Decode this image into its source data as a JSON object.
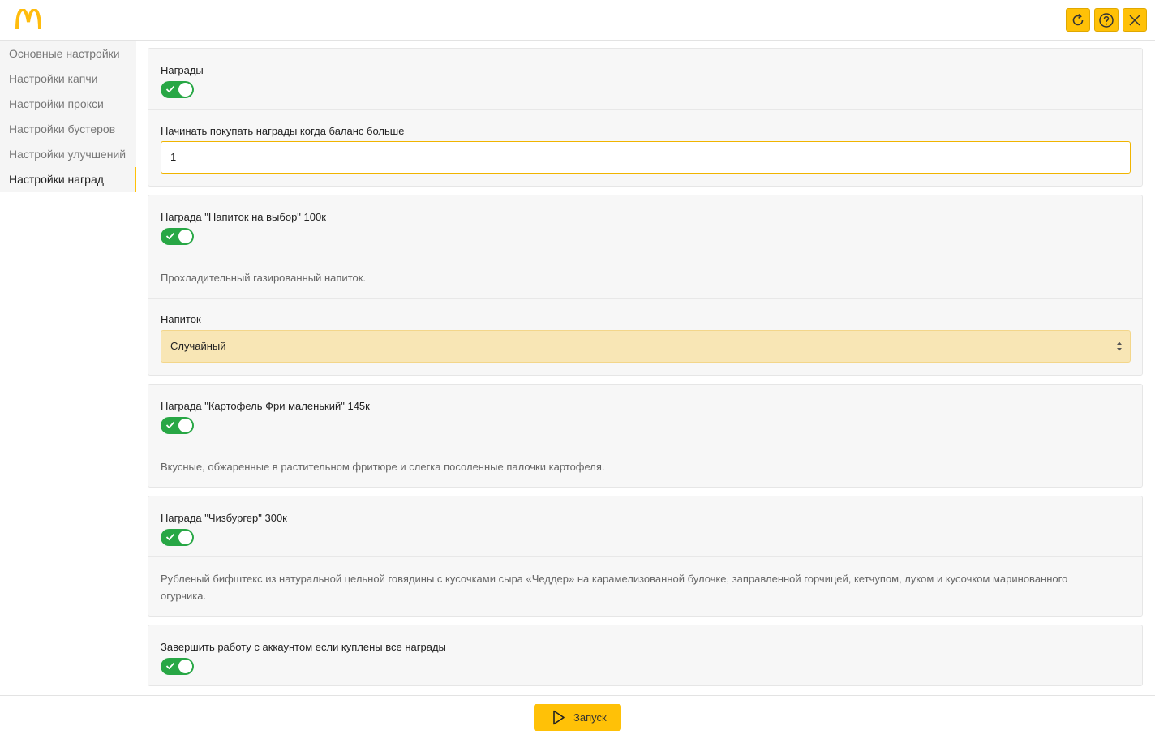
{
  "header": {
    "logo_icon": "mcdonalds-logo-icon",
    "buttons": {
      "refresh_icon": "refresh-icon",
      "help_icon": "help-circle-icon",
      "close_icon": "close-icon"
    },
    "accent_color": "#ffc107"
  },
  "sidebar": {
    "items": [
      {
        "label": "Основные настройки"
      },
      {
        "label": "Настройки капчи"
      },
      {
        "label": "Настройки прокси"
      },
      {
        "label": "Настройки бустеров"
      },
      {
        "label": "Настройки улучшений"
      },
      {
        "label": "Настройки наград",
        "active": true
      }
    ]
  },
  "rewards": {
    "enabled_label": "Награды",
    "enabled": true,
    "balance_label": "Начинать покупать награды когда баланс больше",
    "balance_value": "1"
  },
  "drink": {
    "title": "Награда \"Напиток на выбор\" 100к",
    "enabled": true,
    "description": "Прохладительный газированный напиток.",
    "select_label": "Напиток",
    "select_value": "Случайный"
  },
  "fries": {
    "title": "Награда \"Картофель Фри маленький\" 145к",
    "enabled": true,
    "description": "Вкусные, обжаренные в растительном фритюре и слегка посоленные палочки картофеля."
  },
  "cheeseburger": {
    "title": "Награда \"Чизбургер\" 300к",
    "enabled": true,
    "description": "Рубленый бифштекс из натуральной цельной говядины с кусочками сыра «Чеддер» на карамелизованной булочке, заправленной горчицей, кетчупом, луком и кусочком маринованного огурчика."
  },
  "finish": {
    "label": "Завершить работу с аккаунтом если куплены все награды",
    "enabled": true
  },
  "footer": {
    "start_label": "Запуск",
    "start_icon": "play-icon"
  }
}
